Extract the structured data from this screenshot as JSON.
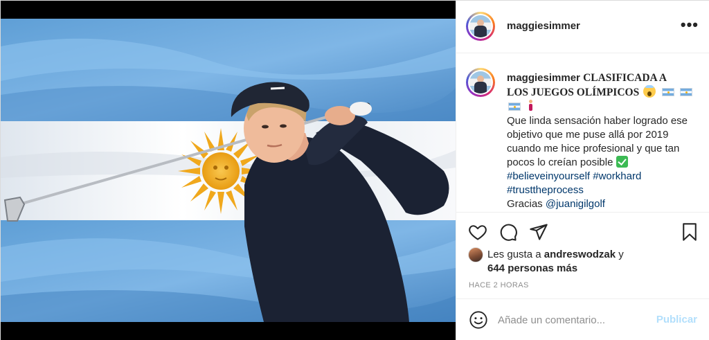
{
  "post": {
    "username": "maggiesimmer",
    "more_label": "•••",
    "caption": {
      "username": "maggiesimmer",
      "title_line1": "CLASIFICADA A",
      "title_line2": "LOS JUEGOS OLÍMPICOS",
      "body": "Que linda sensación haber logrado ese objetivo que me puse allá por 2019 cuando me hice profesional y que tan pocos lo creían posible",
      "hashtags": [
        "#believeinyourself",
        "#workhard",
        "#trusttheprocess"
      ],
      "thanks_prefix": "Gracias",
      "mention": "@juanigilgolf"
    },
    "likes": {
      "prefix": "Les gusta a",
      "user": "andreswodzak",
      "suffix": "y",
      "others": "644 personas más"
    },
    "timestamp": "HACE 2 HORAS",
    "comment": {
      "placeholder": "Añade un comentario...",
      "post_label": "Publicar"
    },
    "icons": {
      "like": "heart-icon",
      "comment": "comment-icon",
      "share": "paper-plane-icon",
      "save": "bookmark-icon",
      "emoji": "smiley-icon",
      "more": "ellipsis-icon"
    },
    "colors": {
      "flag_blue": "#74acdf",
      "flag_white": "#ffffff",
      "sun": "#f6b40e",
      "link": "#00376b",
      "post_button_disabled": "#b2dffc",
      "muted": "#8e8e8e"
    }
  }
}
